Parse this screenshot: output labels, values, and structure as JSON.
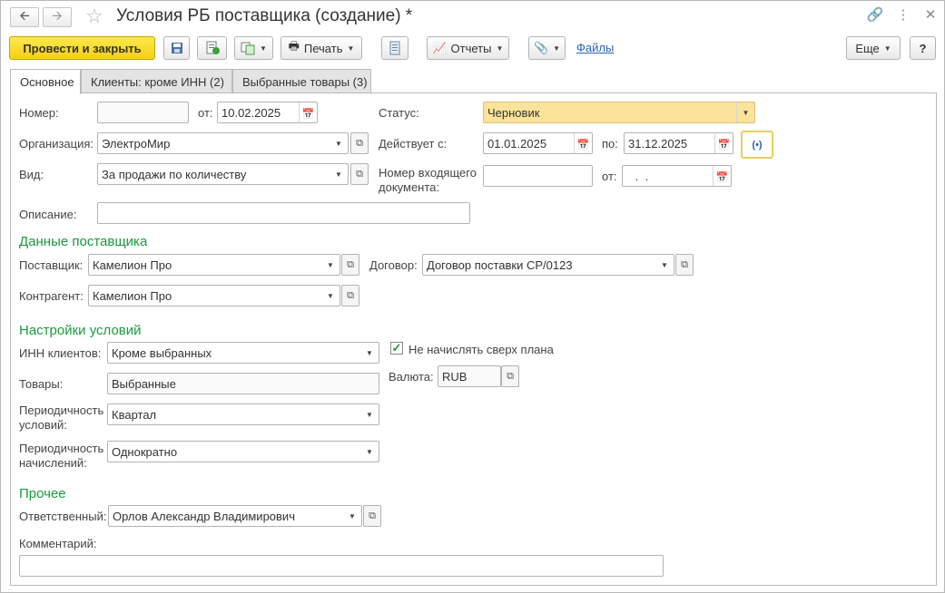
{
  "header": {
    "title": "Условия РБ поставщика (создание) *",
    "back_icon": "arrow-left",
    "forward_icon": "arrow-right",
    "star_icon": "star",
    "link_icon": "link",
    "more_icon": "vertical-ellipsis",
    "close_icon": "close"
  },
  "toolbar": {
    "post_close": "Провести и закрыть",
    "print": "Печать",
    "reports": "Отчеты",
    "files": "Файлы",
    "more": "Еще",
    "help": "?"
  },
  "tabs": [
    {
      "label": "Основное"
    },
    {
      "label": "Клиенты: кроме ИНН (2)"
    },
    {
      "label": "Выбранные товары (3)"
    }
  ],
  "form": {
    "number_label": "Номер:",
    "number_value": "",
    "from_label": "от:",
    "from_value": "10.02.2025",
    "status_label": "Статус:",
    "status_value": "Черновик",
    "org_label": "Организация:",
    "org_value": "ЭлектроМир",
    "valid_from_label": "Действует с:",
    "valid_from_value": "01.01.2025",
    "valid_to_label": "по:",
    "valid_to_value": "31.12.2025",
    "kind_label": "Вид:",
    "kind_value": "За продажи по количеству",
    "incoming_label_1": "Номер входящего",
    "incoming_label_2": "документа:",
    "incoming_value": "",
    "incoming_date_label": "от:",
    "incoming_date_value": " .  .",
    "desc_label": "Описание:",
    "desc_value": ""
  },
  "supplier": {
    "section": "Данные поставщика",
    "supplier_label": "Поставщик:",
    "supplier_value": "Камелион Про",
    "contract_label": "Договор:",
    "contract_value": "Договор поставки СР/0123",
    "counterparty_label": "Контрагент:",
    "counterparty_value": "Камелион Про"
  },
  "conditions": {
    "section": "Настройки условий",
    "inn_label": "ИНН клиентов:",
    "inn_value": "Кроме выбранных",
    "no_over_plan_label": "Не начислять сверх плана",
    "no_over_plan_checked": true,
    "goods_label": "Товары:",
    "goods_value": "Выбранные",
    "currency_label": "Валюта:",
    "currency_value": "RUB",
    "period_cond_label_1": "Периодичность",
    "period_cond_label_2": "условий:",
    "period_cond_value": "Квартал",
    "period_acc_label_1": "Периодичность",
    "period_acc_label_2": "начислений:",
    "period_acc_value": "Однократно"
  },
  "other": {
    "section": "Прочее",
    "responsible_label": "Ответственный:",
    "responsible_value": "Орлов Александр Владимирович",
    "comment_label": "Комментарий:",
    "comment_value": ""
  }
}
